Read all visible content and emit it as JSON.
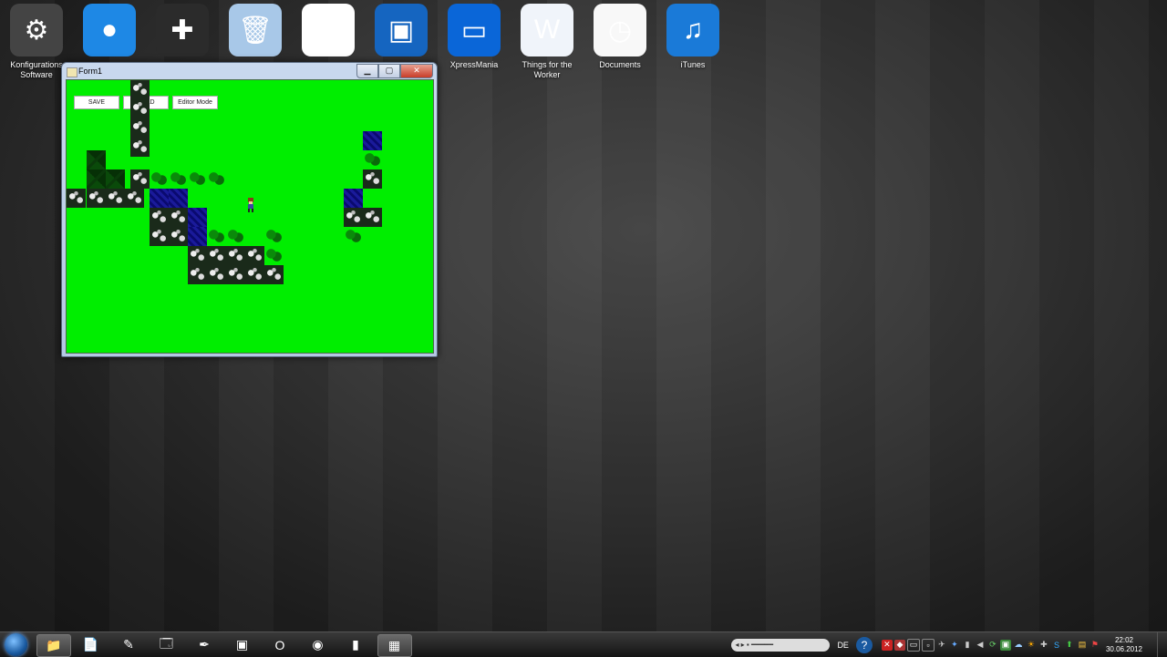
{
  "desktop": {
    "icons": [
      {
        "label": "Konfigurations Software",
        "icon": "gear-icon",
        "color": "#444444",
        "glyph": "⚙",
        "shortcut": false
      },
      {
        "label": "",
        "icon": "film-reel-icon",
        "color": "#1e88e5",
        "glyph": "●",
        "shortcut": true
      },
      {
        "label": "",
        "icon": "gamepad-icon",
        "color": "#2b2b2b",
        "glyph": "✚",
        "shortcut": false
      },
      {
        "label": "",
        "icon": "recycle-bin-icon",
        "color": "#a8c8e8",
        "glyph": "🗑",
        "shortcut": false
      },
      {
        "label": "",
        "icon": "flower-app-icon",
        "color": "#ffffff",
        "glyph": "✿",
        "shortcut": true
      },
      {
        "label": "",
        "icon": "ds-console-icon",
        "color": "#1565c0",
        "glyph": "▣",
        "shortcut": false
      },
      {
        "label": "XpressMania",
        "icon": "laptop-icon",
        "color": "#0a66d8",
        "glyph": "▭",
        "shortcut": false
      },
      {
        "label": "Things for the Worker",
        "icon": "word-document-icon",
        "color": "#f0f4fa",
        "glyph": "W",
        "shortcut": false
      },
      {
        "label": "Documents",
        "icon": "pdf-clock-icon",
        "color": "#f8f8f8",
        "glyph": "◷",
        "shortcut": true
      },
      {
        "label": "iTunes",
        "icon": "itunes-icon",
        "color": "#1a7ad8",
        "glyph": "♫",
        "shortcut": true
      }
    ]
  },
  "window": {
    "title": "Form1",
    "buttons": {
      "save": "SAVE",
      "load": "LOAD",
      "editor": "Editor Mode"
    },
    "controls": {
      "min": "▁",
      "max": "▢",
      "close": "✕"
    }
  },
  "taskbar": {
    "items": [
      {
        "icon": "folder-icon",
        "glyph": "📁",
        "active": true
      },
      {
        "icon": "notepad-icon",
        "glyph": "📄",
        "active": false
      },
      {
        "icon": "paint-brush-icon",
        "glyph": "✎",
        "active": false
      },
      {
        "icon": "explorer-window-icon",
        "glyph": "🗔",
        "active": false
      },
      {
        "icon": "visual-studio-icon",
        "glyph": "✒",
        "active": false
      },
      {
        "icon": "screen-app-icon",
        "glyph": "▣",
        "active": false
      },
      {
        "icon": "opera-icon",
        "glyph": "O",
        "active": false
      },
      {
        "icon": "chrome-icon",
        "glyph": "◉",
        "active": false
      },
      {
        "icon": "terminal-icon",
        "glyph": "▮",
        "active": false
      },
      {
        "icon": "form-window-icon",
        "glyph": "▦",
        "active": true
      }
    ],
    "tray": {
      "language": "DE",
      "time": "22:02",
      "date": "30.06.2012"
    }
  }
}
